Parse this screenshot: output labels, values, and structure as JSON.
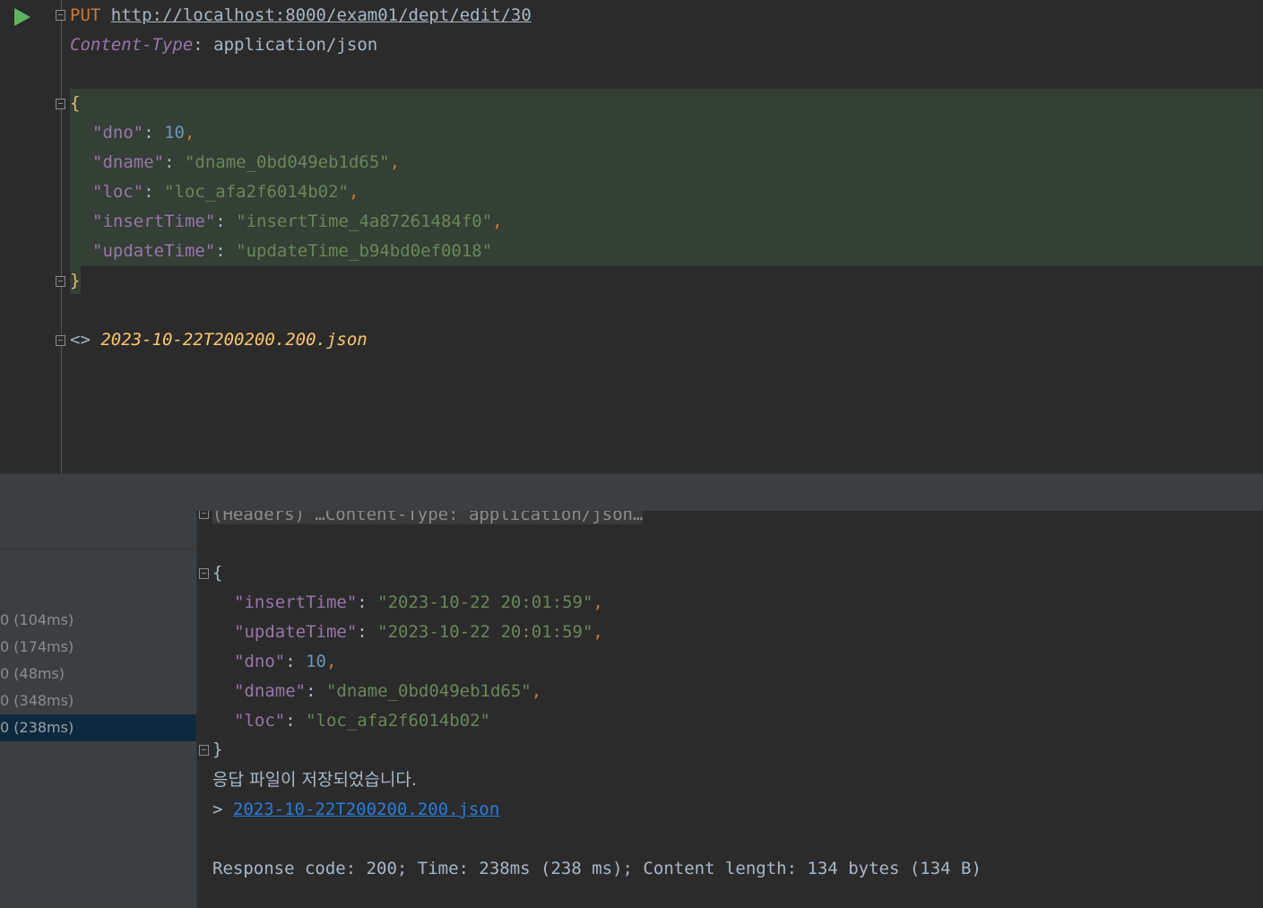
{
  "request": {
    "method": "PUT",
    "url": "http://localhost:8000/exam01/dept/edit/30",
    "header_name": "Content-Type",
    "header_sep": ": ",
    "header_value": "application/json",
    "body_open": "{",
    "body_close": "}",
    "fields": [
      {
        "key": "\"dno\"",
        "value": "10",
        "type": "number",
        "comma": ","
      },
      {
        "key": "\"dname\"",
        "value": "\"dname_0bd049eb1d65\"",
        "type": "string",
        "comma": ","
      },
      {
        "key": "\"loc\"",
        "value": "\"loc_afa2f6014b02\"",
        "type": "string",
        "comma": ","
      },
      {
        "key": "\"insertTime\"",
        "value": "\"insertTime_4a87261484f0\"",
        "type": "string",
        "comma": ","
      },
      {
        "key": "\"updateTime\"",
        "value": "\"updateTime_b94bd0ef0018\"",
        "type": "string",
        "comma": ""
      }
    ],
    "response_ref_prefix": "<> ",
    "response_ref_file": "2023-10-22T200200.200.json"
  },
  "history": [
    "0 (104ms)",
    "0 (174ms)",
    "0 (48ms)",
    "0 (348ms)",
    "0 (238ms)"
  ],
  "response": {
    "headers_collapsed": "(Headers) …Content-Type: application/json…",
    "body_open": "{",
    "body_close": "}",
    "fields": [
      {
        "key": "\"insertTime\"",
        "value": "\"2023-10-22 20:01:59\"",
        "type": "string",
        "comma": ","
      },
      {
        "key": "\"updateTime\"",
        "value": "\"2023-10-22 20:01:59\"",
        "type": "string",
        "comma": ","
      },
      {
        "key": "\"dno\"",
        "value": "10",
        "type": "number",
        "comma": ","
      },
      {
        "key": "\"dname\"",
        "value": "\"dname_0bd049eb1d65\"",
        "type": "string",
        "comma": ","
      },
      {
        "key": "\"loc\"",
        "value": "\"loc_afa2f6014b02\"",
        "type": "string",
        "comma": ""
      }
    ],
    "saved_message": "응답 파일이 저장되었습니다.",
    "saved_prefix": "> ",
    "saved_file": "2023-10-22T200200.200.json",
    "summary": "Response code: 200; Time: 238ms (238 ms); Content length: 134 bytes (134 B)"
  },
  "colors": {
    "editor_bg": "#2b2b2b",
    "panel_bg": "#3c3f41",
    "selection": "#0d293e",
    "highlight": "#343f35"
  }
}
